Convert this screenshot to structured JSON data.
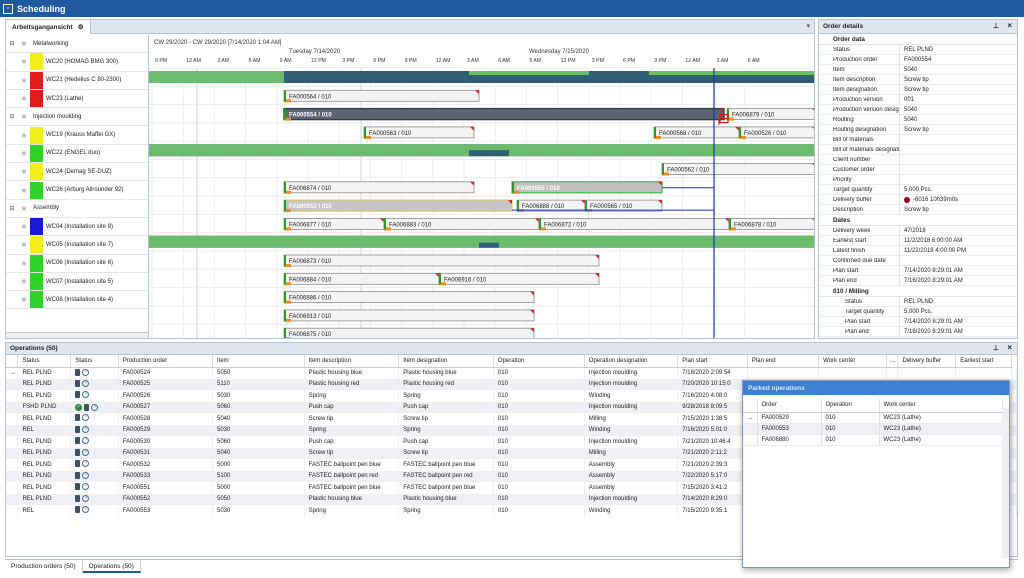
{
  "window": {
    "title": "Scheduling"
  },
  "gantt_tab": {
    "label": "Arbeitsgangansicht"
  },
  "timeline": {
    "range_label": "CW 29/2020 - CW 29/2020   [7/14/2020 1:04 AM]",
    "days": [
      "Tuesday 7/14/2020",
      "Wednesday 7/15/2020"
    ],
    "hours": [
      "9 PM",
      "12 AM",
      "3 AM",
      "6 AM",
      "9 AM",
      "12 PM",
      "3 PM",
      "6 PM",
      "9 PM",
      "12 AM",
      "3 AM",
      "6 AM",
      "9 AM",
      "12 PM",
      "3 PM",
      "6 PM",
      "9 PM",
      "12 AM",
      "3 AM",
      "6 AM"
    ]
  },
  "work_centers": [
    {
      "label": "Metalworking",
      "group": true,
      "color": ""
    },
    {
      "label": "WC20 (HOMAG BMG 300)",
      "group": false,
      "color": "#f2ee1c"
    },
    {
      "label": "WC21 (Hedelius C 80-2300)",
      "group": false,
      "color": "#e21b1b"
    },
    {
      "label": "WC23 (Lathe)",
      "group": false,
      "color": "#e21b1b"
    },
    {
      "label": "Injection moulding",
      "group": true,
      "color": ""
    },
    {
      "label": "WC19 (Krauss Maffei GX)",
      "group": false,
      "color": "#f2ee1c"
    },
    {
      "label": "WC22 (ENGEL duo)",
      "group": false,
      "color": "#31d12b"
    },
    {
      "label": "WC24 (Demag SE-DUZ)",
      "group": false,
      "color": "#f2ee1c"
    },
    {
      "label": "WC26 (Arburg Allrounder 92)",
      "group": false,
      "color": "#31d12b"
    },
    {
      "label": "Assembly",
      "group": true,
      "color": ""
    },
    {
      "label": "WC04 (Installation site 8)",
      "group": false,
      "color": "#1b19d8"
    },
    {
      "label": "WC05 (Installation site 7)",
      "group": false,
      "color": "#f2ee1c"
    },
    {
      "label": "WC06 (Installation site 6)",
      "group": false,
      "color": "#31d12b"
    },
    {
      "label": "WC07 (Installation site 5)",
      "group": false,
      "color": "#31d12b"
    },
    {
      "label": "WC08 (Installation site 4)",
      "group": false,
      "color": "#31d12b"
    }
  ],
  "gantt_bars": [
    {
      "label": "FA000564 / 010"
    },
    {
      "label": "FA000554 / 010"
    },
    {
      "label": "FA006879 / 010"
    },
    {
      "label": "FA000563 / 010"
    },
    {
      "label": "FA000568 / 010"
    },
    {
      "label": "FA000526 / 010"
    },
    {
      "label": "FA000562 / 010"
    },
    {
      "label": "FA006874 / 010"
    },
    {
      "label": "FA000555 / 010"
    },
    {
      "label": "FA000552 / 010"
    },
    {
      "label": "FA006888 / 010"
    },
    {
      "label": "FA000565 / 010"
    },
    {
      "label": "FA006877 / 010"
    },
    {
      "label": "FA006883 / 010"
    },
    {
      "label": "FA006872 / 010"
    },
    {
      "label": "FA006878 / 010"
    },
    {
      "label": "FA006873 / 010"
    },
    {
      "label": "FA006884 / 010"
    },
    {
      "label": "FA006916 / 010"
    },
    {
      "label": "FA006886 / 010"
    },
    {
      "label": "FA006913 / 010"
    },
    {
      "label": "FA006875 / 010"
    }
  ],
  "order_details": {
    "title": "Order details",
    "sections": [
      {
        "title": "Order data",
        "rows": [
          {
            "k": "Status",
            "v": "REL PLND"
          },
          {
            "k": "Production order",
            "v": "FA000554"
          },
          {
            "k": "Item",
            "v": "5040"
          },
          {
            "k": "Item description",
            "v": "Screw tip"
          },
          {
            "k": "Item designation",
            "v": "Screw tip"
          },
          {
            "k": "Production version",
            "v": "001"
          },
          {
            "k": "Production version design...",
            "v": "5040"
          },
          {
            "k": "Routing",
            "v": "5040"
          },
          {
            "k": "Routing designation",
            "v": "Screw tip"
          },
          {
            "k": "Bill of materials",
            "v": ""
          },
          {
            "k": "Bill of materials designation",
            "v": ""
          },
          {
            "k": "Client number",
            "v": ""
          },
          {
            "k": "Customer order",
            "v": ""
          },
          {
            "k": "Priority",
            "v": ""
          },
          {
            "k": "Target quantity",
            "v": "5,000 Pcs."
          },
          {
            "k": "Delivery buffer",
            "v": "-6016 10h39m0s",
            "dot": true
          },
          {
            "k": "Description",
            "v": "Screw tip"
          }
        ]
      },
      {
        "title": "Dates",
        "rows": [
          {
            "k": "Delivery week",
            "v": "47/2018"
          },
          {
            "k": "Earliest start",
            "v": "11/2/2018 6:00:00 AM"
          },
          {
            "k": "Latest finish",
            "v": "11/22/2018 4:00:00 PM"
          },
          {
            "k": "Confirmed due date",
            "v": ""
          },
          {
            "k": "Plan start",
            "v": "7/14/2020 8:29:01 AM"
          },
          {
            "k": "Plan end",
            "v": "7/16/2020 8:29:01 AM"
          }
        ]
      },
      {
        "title": "010 / Milling",
        "sub": true,
        "rows": [
          {
            "k": "Status",
            "v": "REL PLND"
          },
          {
            "k": "Target quantity",
            "v": "5,000 Pcs."
          },
          {
            "k": "Plan start",
            "v": "7/14/2020 8:29:01 AM"
          },
          {
            "k": "Plan end",
            "v": "7/16/2020 8:29:01 AM"
          }
        ]
      }
    ]
  },
  "operations": {
    "title": "Operations (50)",
    "columns": [
      "Status",
      "Status",
      "Production order",
      "Item",
      "Item description",
      "Item designation",
      "Operation",
      "Operation designation",
      "Plan start",
      "Plan end",
      "Work center",
      "...",
      "Delivery buffer",
      "Earliest start"
    ],
    "rows": [
      [
        "REL PLND",
        "FA000524",
        "5050",
        "Plastic housing blue",
        "Plastic housing blue",
        "010",
        "Injection moulding",
        "7/18/2020 2:09:54"
      ],
      [
        "REL PLND",
        "FA000525",
        "5110",
        "Plastic housing red",
        "Plastic housing red",
        "010",
        "Injection moulding",
        "7/20/2020 10:15:0"
      ],
      [
        "REL PLND",
        "FA000526",
        "5030",
        "Spring",
        "Spring",
        "010",
        "Winding",
        "7/16/2020 4:08:0"
      ],
      [
        "FSHD PLND",
        "FA000527",
        "5060",
        "Push cap",
        "Push cap",
        "010",
        "Injection moulding",
        "9/28/2018 8:09:5"
      ],
      [
        "REL PLND",
        "FA000528",
        "5040",
        "Screw tip",
        "Screw tip",
        "010",
        "Milling",
        "7/15/2020 1:38:5"
      ],
      [
        "REL",
        "FA000529",
        "5030",
        "Spring",
        "Spring",
        "010",
        "Winding",
        "7/16/2020 5:01:0"
      ],
      [
        "REL PLND",
        "FA000530",
        "5060",
        "Push cap",
        "Push cap",
        "010",
        "Injection moulding",
        "7/21/2020 10:46:4"
      ],
      [
        "REL PLND",
        "FA000531",
        "5040",
        "Screw tip",
        "Screw tip",
        "010",
        "Milling",
        "7/21/2020 2:11:2"
      ],
      [
        "REL PLND",
        "FA000532",
        "5000",
        "FASTEC ballpoint pen blue",
        "FASTEC ballpoint pen blue",
        "010",
        "Assembly",
        "7/21/2020 2:39:3"
      ],
      [
        "REL PLND",
        "FA000533",
        "5100",
        "FASTEC ballpoint pen red",
        "FASTEC ballpoint pen red",
        "010",
        "Assembly",
        "7/22/2020 5:17:0"
      ],
      [
        "REL PLND",
        "FA000551",
        "5000",
        "FASTEC ballpoint pen blue",
        "FASTEC ballpoint pen blue",
        "010",
        "Assembly",
        "7/15/2020 3:41:2"
      ],
      [
        "REL PLND",
        "FA000552",
        "5050",
        "Plastic housing blue",
        "Plastic housing blue",
        "010",
        "Injection moulding",
        "7/14/2020 8:29:0"
      ],
      [
        "REL",
        "FA000553",
        "5030",
        "Spring",
        "Spring",
        "010",
        "Winding",
        "7/15/2020 9:35:1"
      ]
    ],
    "row_status_icons": [
      "",
      "",
      "",
      "check",
      "",
      "",
      "",
      "",
      "",
      "",
      "",
      "",
      ""
    ]
  },
  "bottom_tabs": [
    {
      "label": "Production orders (50)"
    },
    {
      "label": "Operations (50)"
    }
  ],
  "parked": {
    "title": "Parked operations",
    "columns": [
      "Order",
      "Operation",
      "Work center"
    ],
    "rows": [
      [
        "FA000529",
        "010",
        "WC23 (Lathe)"
      ],
      [
        "FA000553",
        "010",
        "WC23 (Lathe)"
      ],
      [
        "FA006880",
        "010",
        "WC23 (Lathe)"
      ]
    ]
  }
}
